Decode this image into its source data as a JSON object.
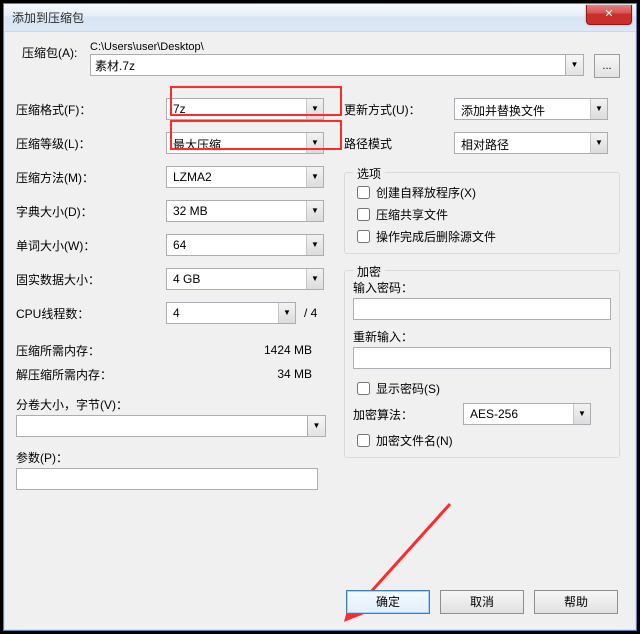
{
  "window": {
    "title": "添加到压缩包",
    "close_glyph": "✕"
  },
  "path": {
    "label": "压缩包(A):",
    "prefix": "C:\\Users\\user\\Desktop\\",
    "file": "素材.7z",
    "browse": "..."
  },
  "left": {
    "format_label": "压缩格式(F)：",
    "format_value": "7z",
    "level_label": "压缩等级(L)：",
    "level_value": "最大压缩",
    "method_label": "压缩方法(M)：",
    "method_value": "LZMA2",
    "dict_label": "字典大小(D)：",
    "dict_value": "32 MB",
    "word_label": "单词大小(W)：",
    "word_value": "64",
    "solid_label": "固实数据大小：",
    "solid_value": "4 GB",
    "cpu_label": "CPU线程数：",
    "cpu_value": "4",
    "cpu_total": "/ 4",
    "mem_comp_label": "压缩所需内存：",
    "mem_comp_value": "1424 MB",
    "mem_decomp_label": "解压缩所需内存：",
    "mem_decomp_value": "34 MB",
    "split_label": "分卷大小，字节(V)：",
    "params_label": "参数(P)："
  },
  "right": {
    "update_label": "更新方式(U)：",
    "update_value": "添加并替换文件",
    "pathmode_label": "路径模式",
    "pathmode_value": "相对路径",
    "options_legend": "选项",
    "opt_sfx": "创建自释放程序(X)",
    "opt_share": "压缩共享文件",
    "opt_delete": "操作完成后删除源文件",
    "encrypt_legend": "加密",
    "pwd_label": "输入密码：",
    "pwd2_label": "重新输入：",
    "show_pwd": "显示密码(S)",
    "algo_label": "加密算法：",
    "algo_value": "AES-256",
    "encrypt_names": "加密文件名(N)"
  },
  "buttons": {
    "ok": "确定",
    "cancel": "取消",
    "help": "帮助"
  }
}
